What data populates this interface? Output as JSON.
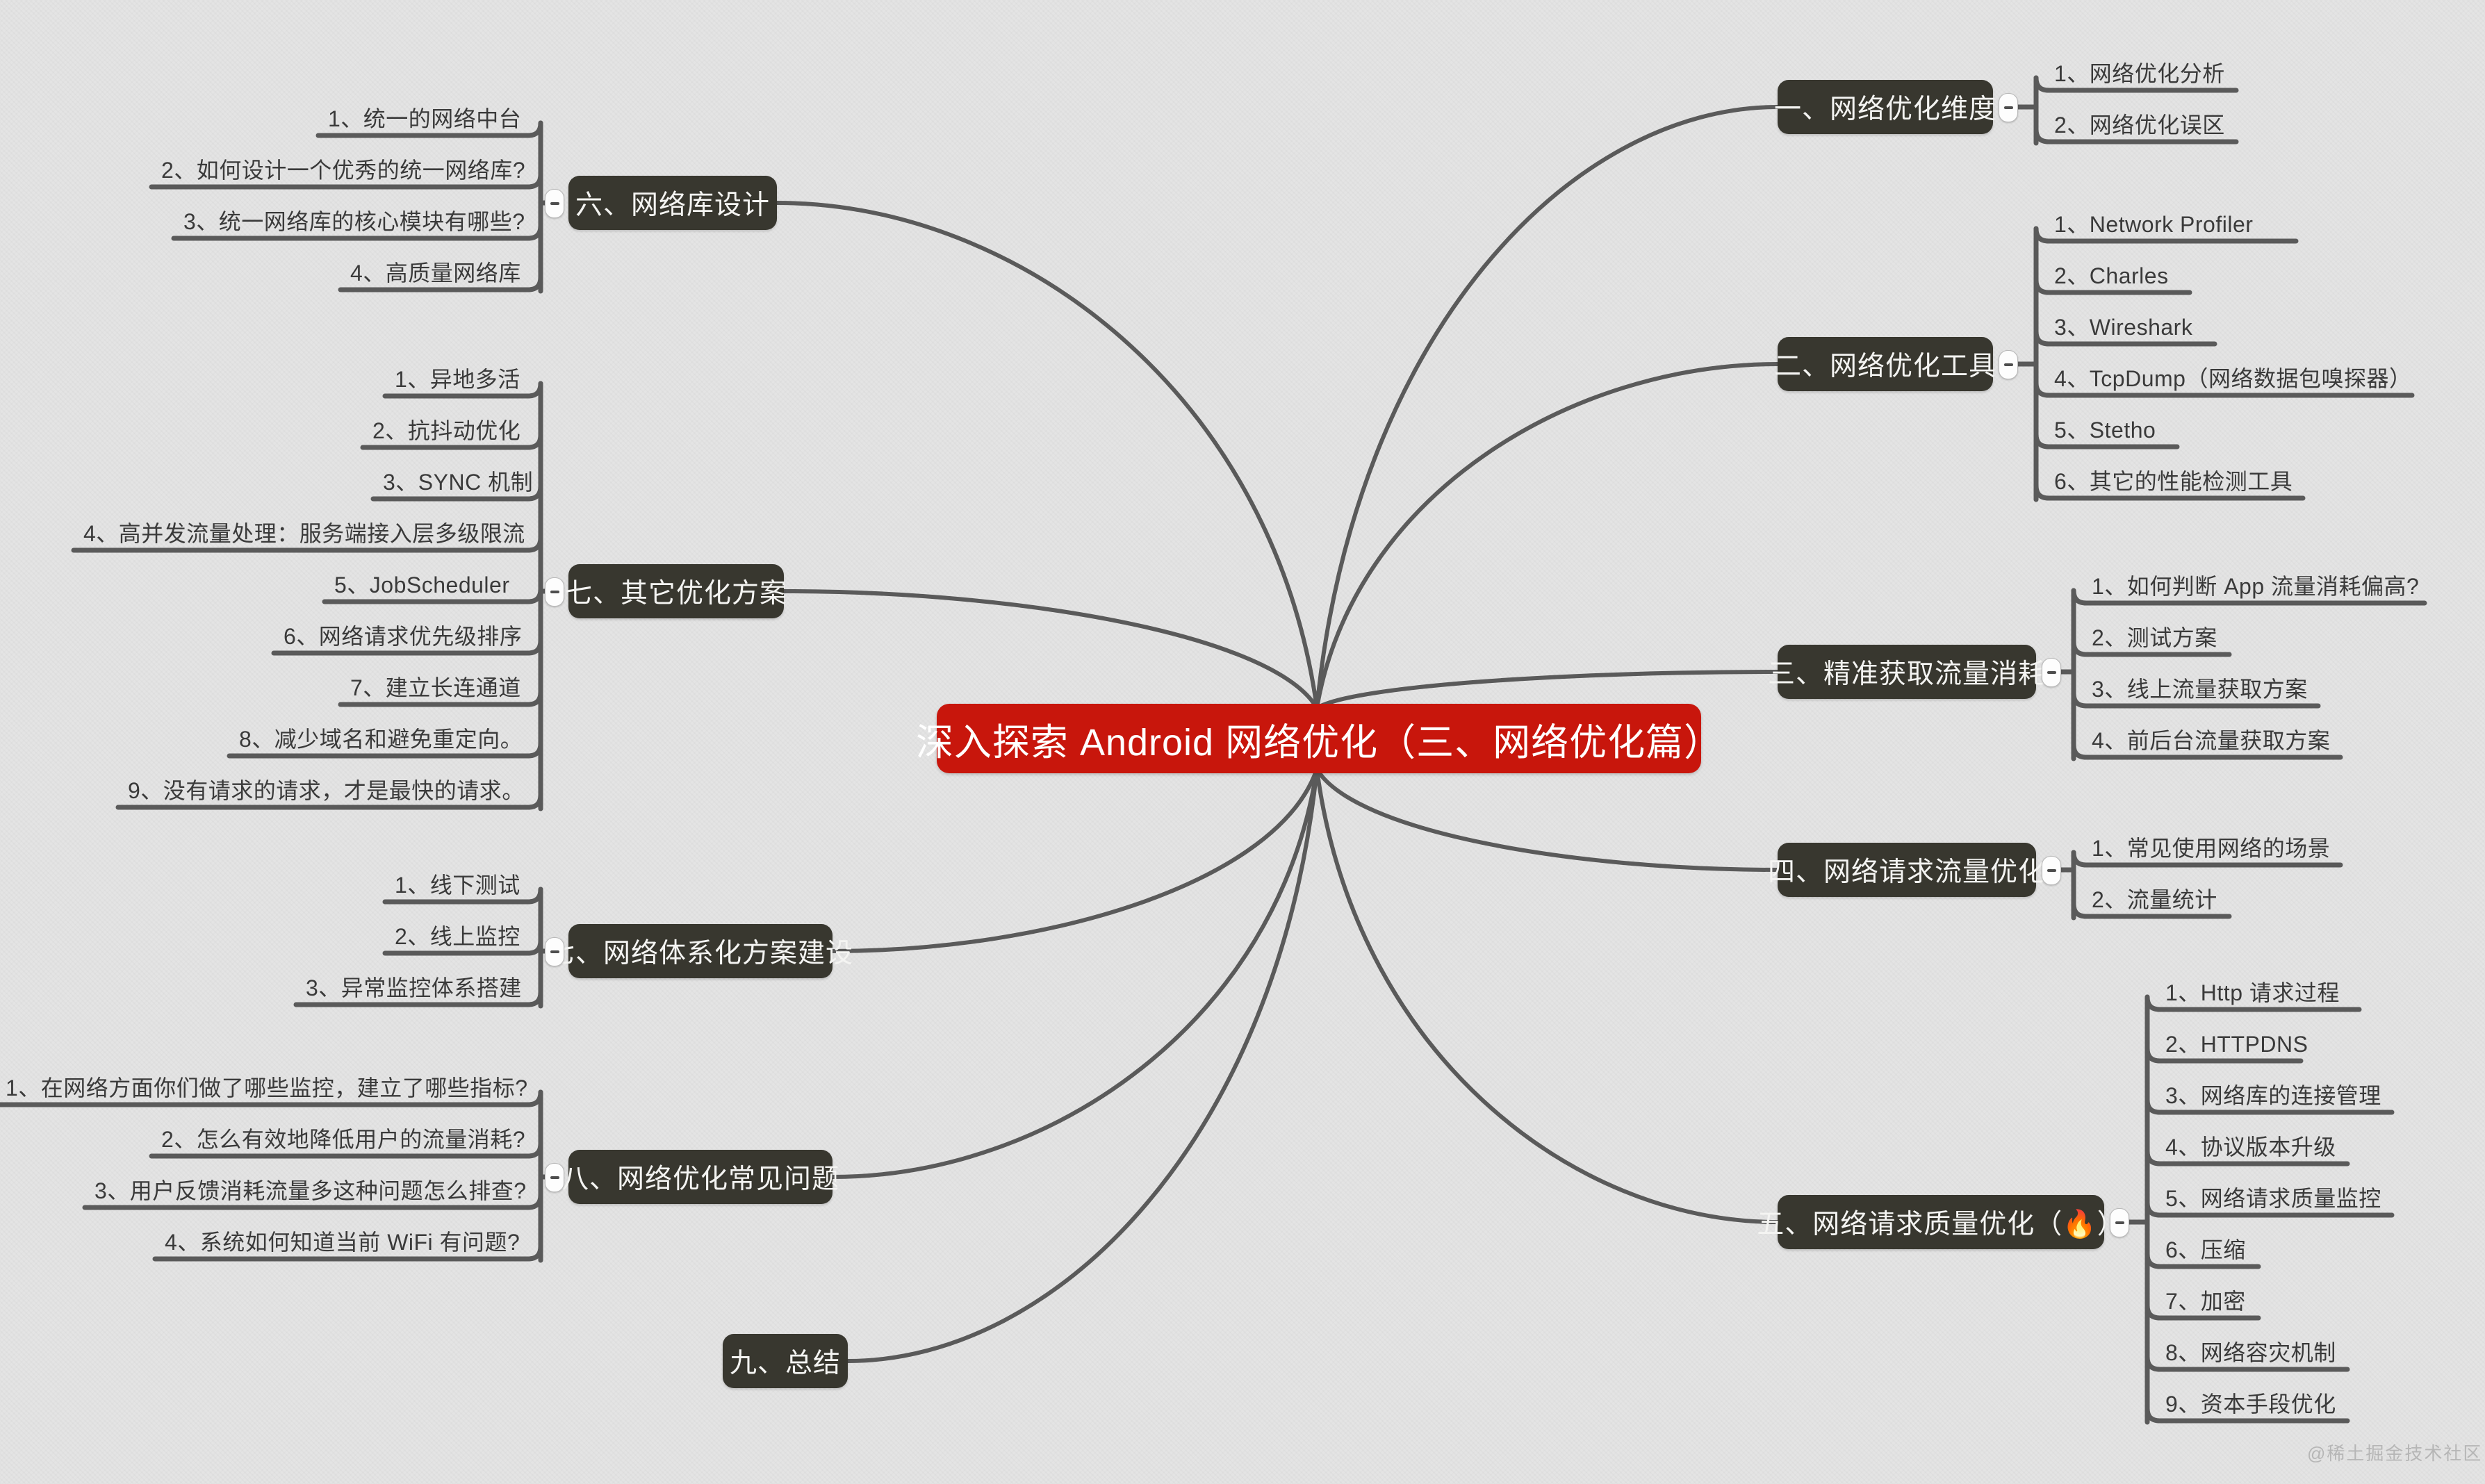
{
  "root": {
    "label": "深入探索 Android 网络优化（三、网络优化篇）",
    "color": "#c8160c",
    "text_color": "#ffffff"
  },
  "theme": {
    "branch_bg": "#38372f",
    "branch_text": "#f4f4f2",
    "line_color": "#5a5a5a",
    "canvas_bg": "#e3e3e3",
    "leaf_text": "#3a3a3a"
  },
  "watermark": {
    "text": "@稀土掘金技术社区"
  },
  "toggle": {
    "icon": "minus-icon"
  },
  "branches": [
    {
      "id": "b1",
      "side": "right",
      "label": "一、网络优化维度",
      "children": [
        "1、网络优化分析",
        "2、网络优化误区"
      ]
    },
    {
      "id": "b2",
      "side": "right",
      "label": "二、网络优化工具",
      "children": [
        "1、Network Profiler",
        "2、Charles",
        "3、Wireshark",
        "4、TcpDump（网络数据包嗅探器）",
        "5、Stetho",
        "6、其它的性能检测工具"
      ]
    },
    {
      "id": "b3",
      "side": "right",
      "label": "三、精准获取流量消耗",
      "children": [
        "1、如何判断 App 流量消耗偏高?",
        "2、测试方案",
        "3、线上流量获取方案",
        "4、前后台流量获取方案"
      ]
    },
    {
      "id": "b4",
      "side": "right",
      "label": "四、网络请求流量优化",
      "children": [
        "1、常见使用网络的场景",
        "2、流量统计"
      ]
    },
    {
      "id": "b5",
      "side": "right",
      "label": "五、网络请求质量优化（🔥）",
      "children": [
        "1、Http 请求过程",
        "2、HTTPDNS",
        "3、网络库的连接管理",
        "4、协议版本升级",
        "5、网络请求质量监控",
        "6、压缩",
        "7、加密",
        "8、网络容灾机制",
        "9、资本手段优化"
      ]
    },
    {
      "id": "b6",
      "side": "left",
      "label": "六、网络库设计",
      "children": [
        "1、统一的网络中台",
        "2、如何设计一个优秀的统一网络库?",
        "3、统一网络库的核心模块有哪些?",
        "4、高质量网络库"
      ]
    },
    {
      "id": "b7",
      "side": "left",
      "label": "七、其它优化方案",
      "children": [
        "1、异地多活",
        "2、抗抖动优化",
        "3、SYNC 机制",
        "4、高并发流量处理：服务端接入层多级限流",
        "5、JobScheduler",
        "6、网络请求优先级排序",
        "7、建立长连通道",
        "8、减少域名和避免重定向。",
        "9、没有请求的请求，才是最快的请求。"
      ]
    },
    {
      "id": "b8",
      "side": "left",
      "label": "七、网络体系化方案建设",
      "children": [
        "1、线下测试",
        "2、线上监控",
        "3、异常监控体系搭建"
      ]
    },
    {
      "id": "b9",
      "side": "left",
      "label": "八、网络优化常见问题",
      "children": [
        "1、在网络方面你们做了哪些监控，建立了哪些指标?",
        "2、怎么有效地降低用户的流量消耗?",
        "3、用户反馈消耗流量多这种问题怎么排查?",
        "4、系统如何知道当前 WiFi 有问题?"
      ]
    },
    {
      "id": "b10",
      "side": "left",
      "label": "九、总结",
      "children": []
    }
  ]
}
